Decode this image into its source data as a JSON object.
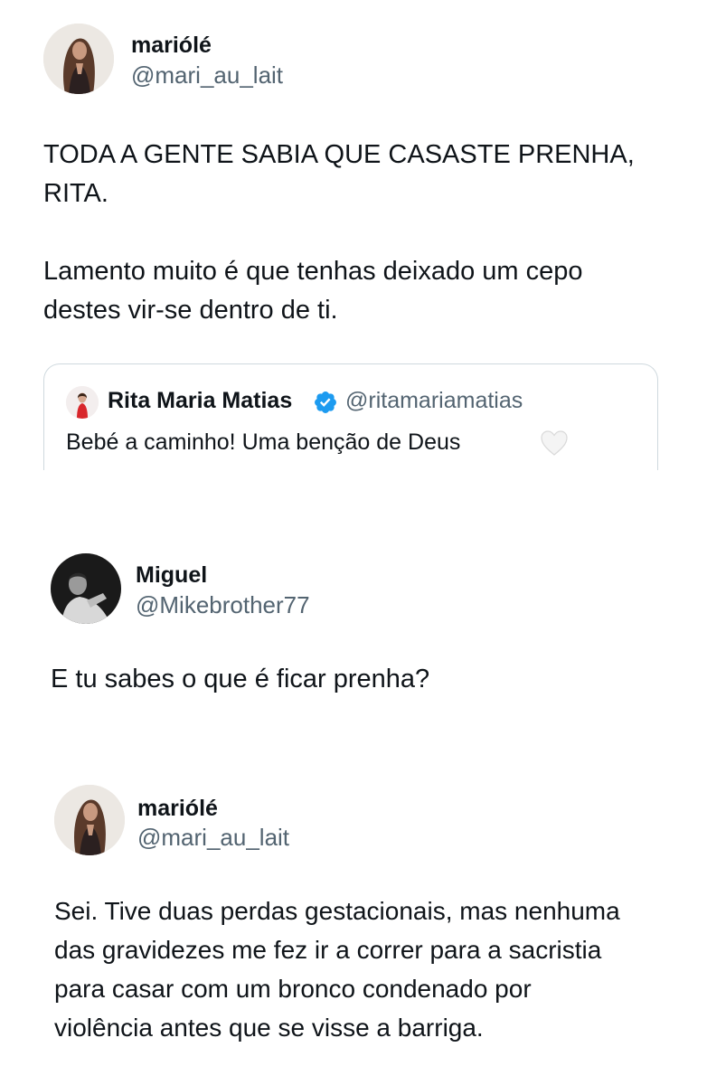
{
  "tweets": [
    {
      "name": "mariólé",
      "handle": "@mari_au_lait",
      "body": "TODA A GENTE SABIA QUE CASASTE PRENHA,\nRITA.\n\nLamento muito é que tenhas deixado um cepo\ndestes vir-se dentro de ti.",
      "avatar_icon": "profile-photo-long-hair"
    },
    {
      "name": "Miguel",
      "handle": "@Mikebrother77",
      "body": "E tu sabes o que é ficar prenha?",
      "avatar_icon": "profile-photo-dark"
    },
    {
      "name": "mariólé",
      "handle": "@mari_au_lait",
      "body": "Sei. Tive duas perdas gestacionais, mas nenhuma\ndas gravidezes me fez ir a correr para a sacristia\npara casar com um bronco condenado por\nviolência antes que se visse a barriga.",
      "avatar_icon": "profile-photo-long-hair"
    }
  ],
  "quote": {
    "name": "Rita Maria Matias",
    "handle": "@ritamariamatias",
    "text": "Bebé a caminho! Uma benção de Deus",
    "verified_icon": "verified-badge-icon",
    "emoji_icon": "white-heart-icon",
    "badge_color": "#1d9bf0"
  },
  "colors": {
    "text": "#0f1419",
    "secondary": "#536471",
    "border": "#cfd9de"
  }
}
